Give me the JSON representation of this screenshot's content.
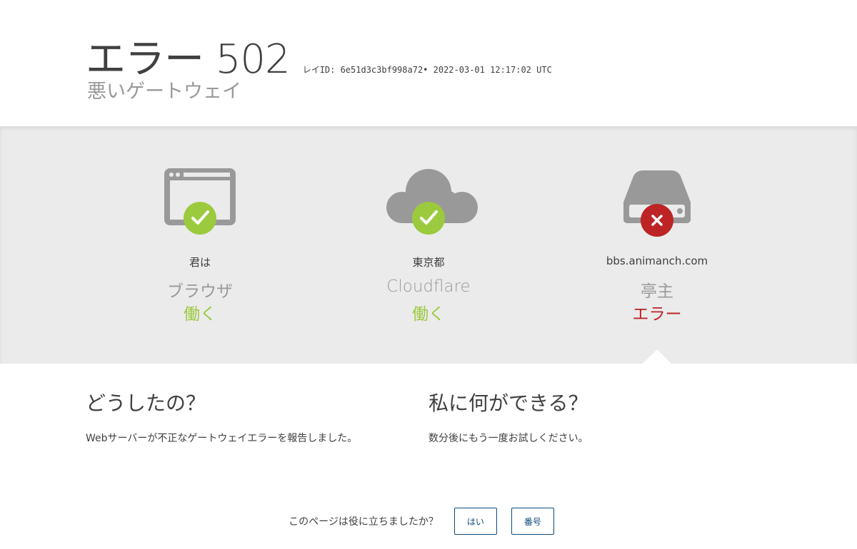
{
  "header": {
    "title": "エラー 502",
    "ray_info": "レイID: 6e51d3c3bf998a72• 2022-03-01 12:17:02 UTC",
    "subtitle": "悪いゲートウェイ"
  },
  "nodes": [
    {
      "location": "君は",
      "name": "ブラウザ",
      "status": "働く",
      "state": "ok",
      "icon": "browser-icon"
    },
    {
      "location": "東京都",
      "name": "Cloudflare",
      "status": "働く",
      "state": "ok",
      "icon": "cloud-icon"
    },
    {
      "location": "bbs.animanch.com",
      "name": "亭主",
      "status": "エラー",
      "state": "error",
      "icon": "server-icon"
    }
  ],
  "what_happened": {
    "heading": "どうしたの？",
    "body": "Webサーバーが不正なゲートウェイエラーを報告しました。"
  },
  "what_can_i_do": {
    "heading": "私に何ができる？",
    "body": "数分後にもう一度お試しください。"
  },
  "feedback": {
    "question": "このページは役に立ちましたか？",
    "yes_label": "はい",
    "no_label": "番号"
  },
  "colors": {
    "ok": "#9bca3e",
    "error": "#bd2426",
    "icon_gray": "#999999",
    "band": "#ebebeb"
  }
}
